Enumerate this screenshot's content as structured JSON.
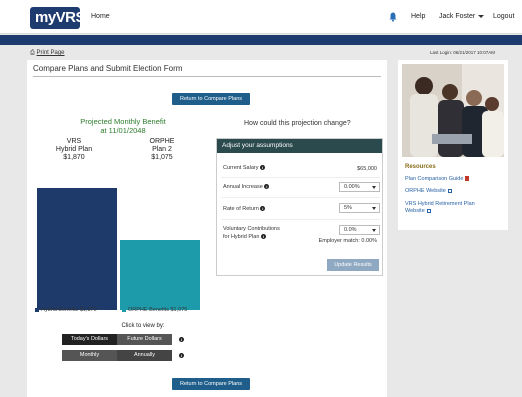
{
  "header": {
    "logo_text": "myVRS",
    "home_label": "Home",
    "help_label": "Help",
    "user_label": "Jack Foster",
    "logout_label": "Logout"
  },
  "subbar": {
    "print_label": "Print Page",
    "last_login": "Last Login: 06/21/2017 10:07AM"
  },
  "main": {
    "page_title": "Compare Plans and Submit Election Form",
    "return_button_label": "Return to Compare Plans",
    "projection": {
      "title_line1": "Projected Monthly Benefit",
      "title_line2": "at 11/01/2048",
      "plans": [
        {
          "name_line1": "VRS",
          "name_line2": "Hybrid Plan",
          "amount": "$1,870"
        },
        {
          "name_line1": "ORPHE",
          "name_line2": "Plan 2",
          "amount": "$1,075"
        }
      ]
    },
    "chart_data": {
      "type": "bar",
      "categories": [
        "Hybrid Benefits $1,870",
        "ORPHE Benefits $1,075"
      ],
      "values": [
        1870,
        1075
      ],
      "colors": [
        "#1d3a6b",
        "#1e9bab"
      ],
      "title": "",
      "xlabel": "",
      "ylabel": "",
      "ylim": [
        0,
        2300
      ]
    },
    "click_to_view": "Click to view by:",
    "toggles": {
      "todays_dollars": "Today's Dollars",
      "future_dollars": "Future Dollars",
      "monthly": "Monthly",
      "annually": "Annually"
    },
    "question": "How could this projection change?",
    "adjust": {
      "header": "Adjust your assumptions",
      "current_salary_label": "Current Salary",
      "current_salary_value": "$65,000",
      "annual_increase_label": "Annual Increase",
      "annual_increase_value": "0.00%",
      "rate_of_return_label": "Rate of Return",
      "rate_of_return_value": "5%",
      "voluntary_label_line1": "Voluntary Contributions",
      "voluntary_label_line2": "for Hybrid Plan",
      "voluntary_value": "0.0%",
      "employer_match": "Employer match: 0.00%",
      "update_button": "Update Results"
    }
  },
  "sidebar": {
    "resources_title": "Resources",
    "links": [
      "Plan Comparison Guide",
      "ORPHE Website",
      "VRS Hybrid Retirement Plan",
      "Website"
    ]
  },
  "colors": {
    "navy": "#1d3b6e",
    "teal": "#1e9bab",
    "button_blue": "#1f5e8a",
    "green_title": "#2e7d2e",
    "panel_head": "#2a4a4e"
  }
}
